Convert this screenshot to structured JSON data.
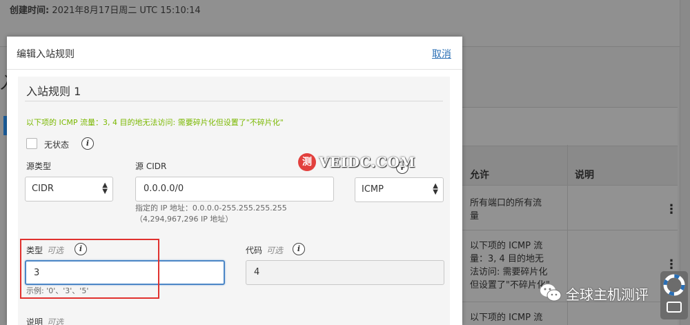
{
  "background": {
    "created_label": "创建时间:",
    "created_value": "2021年8月17日周二 UTC 15:10:14",
    "table": {
      "headers": [
        "允许",
        "说明"
      ],
      "rows": [
        {
          "allow": [
            "所有端口的所有流",
            "量"
          ]
        },
        {
          "allow": [
            "以下项的 ICMP 流",
            "量：3, 4 目的地无",
            "法访问: 需要碎片化",
            "但设置了\"不碎片化\""
          ]
        },
        {
          "allow": [
            "以下项的 ICMP 流"
          ]
        }
      ]
    }
  },
  "modal": {
    "title": "编辑入站规则",
    "cancel": "取消",
    "rule_title": "入站规则 1",
    "warning": "以下项的 ICMP 流量：3, 4 目的地无法访问: 需要碎片化但设置了\"不碎片化\"",
    "stateless_label": "无状态",
    "source_type": {
      "label": "源类型",
      "value": "CIDR"
    },
    "source_cidr": {
      "label": "源 CIDR",
      "value": "0.0.0.0/0",
      "hint_line1": "指定的 IP 地址：0.0.0.0-255.255.255.255",
      "hint_line2": "（4,294,967,296 IP 地址）"
    },
    "protocol": {
      "value": "ICMP"
    },
    "type_field": {
      "label": "类型",
      "optional": "可选",
      "value": "3",
      "example": "示例: '0'、'3'、'5'"
    },
    "code_field": {
      "label": "代码",
      "optional": "可选",
      "value": "4"
    },
    "description": {
      "label": "说明",
      "optional": "可选"
    }
  },
  "watermark": {
    "badge": "测",
    "site": "VEIDC.COM",
    "wechat": "全球主机测评"
  }
}
